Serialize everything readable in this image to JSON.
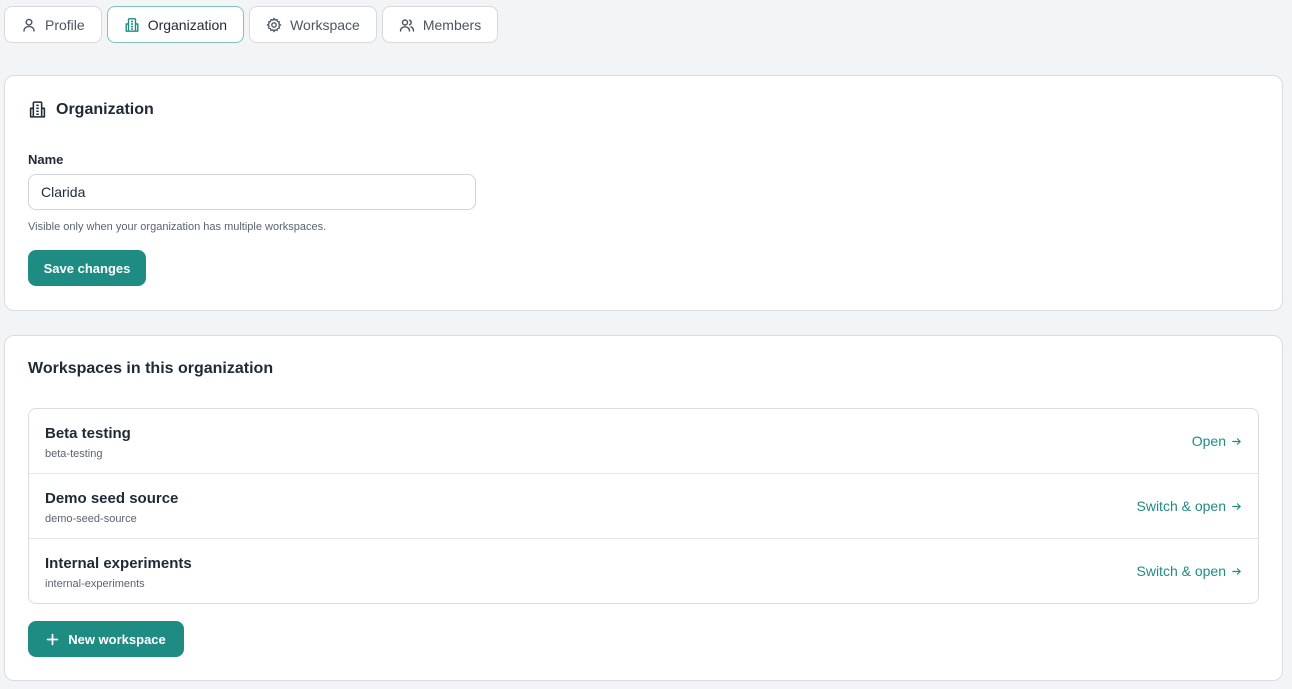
{
  "tabs": [
    {
      "label": "Profile",
      "icon": "user-icon",
      "active": false
    },
    {
      "label": "Organization",
      "icon": "building-icon",
      "active": true
    },
    {
      "label": "Workspace",
      "icon": "gear-icon",
      "active": false
    },
    {
      "label": "Members",
      "icon": "users-icon",
      "active": false
    }
  ],
  "organization": {
    "title": "Organization",
    "name_label": "Name",
    "name_value": "Clarida",
    "hint": "Visible only when your organization has multiple workspaces.",
    "save_label": "Save changes"
  },
  "workspaces": {
    "title": "Workspaces in this organization",
    "items": [
      {
        "name": "Beta testing",
        "slug": "beta-testing",
        "action": "Open"
      },
      {
        "name": "Demo seed source",
        "slug": "demo-seed-source",
        "action": "Switch & open"
      },
      {
        "name": "Internal experiments",
        "slug": "internal-experiments",
        "action": "Switch & open"
      }
    ],
    "new_label": "New workspace"
  },
  "colors": {
    "accent": "#1f8c84",
    "background": "#f3f4f6"
  }
}
